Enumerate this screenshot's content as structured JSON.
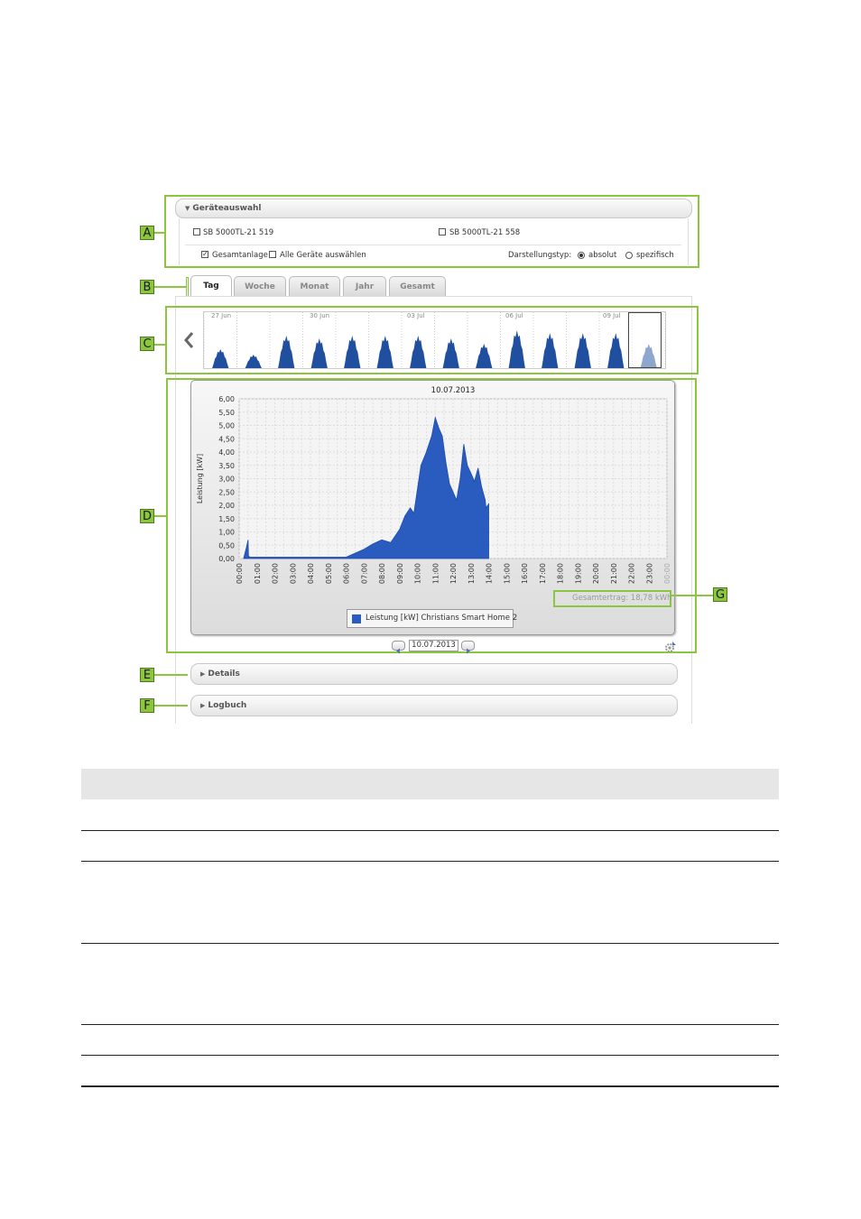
{
  "device_selection": {
    "header": "Geräteauswahl",
    "devices": [
      "SB 5000TL-21 519",
      "SB 5000TL-21 558"
    ],
    "total_plant_label": "Gesamtanlage",
    "total_plant_checked": true,
    "select_all_label": "Alle Geräte auswählen",
    "display_type_label": "Darstellungstyp:",
    "display_absolute": "absolut",
    "display_specific": "spezifisch",
    "display_selected": "absolut"
  },
  "tabs": [
    {
      "label": "Tag",
      "active": true
    },
    {
      "label": "Woche",
      "active": false
    },
    {
      "label": "Monat",
      "active": false
    },
    {
      "label": "Jahr",
      "active": false
    },
    {
      "label": "Gesamt",
      "active": false
    }
  ],
  "timeline": {
    "date_labels": [
      "27 Jun",
      "30 Jun",
      "03 Jul",
      "06 Jul",
      "09 Jul"
    ],
    "prev_icon": "chevron-left-icon"
  },
  "callouts": [
    "A",
    "B",
    "C",
    "D",
    "E",
    "F",
    "G"
  ],
  "chart_data": {
    "type": "area",
    "title": "10.07.2013",
    "ylabel": "Leistung [kW]",
    "xlabel": "",
    "ylim": [
      0,
      6
    ],
    "yticks": [
      "6,00",
      "5,50",
      "5,00",
      "4,50",
      "4,00",
      "3,50",
      "3,00",
      "2,50",
      "2,00",
      "1,50",
      "1,00",
      "0,50",
      "0,00"
    ],
    "xticks": [
      "00:00",
      "01:00",
      "02:00",
      "03:00",
      "04:00",
      "05:00",
      "06:00",
      "07:00",
      "08:00",
      "09:00",
      "10:00",
      "11:00",
      "12:00",
      "13:00",
      "14:00",
      "15:00",
      "16:00",
      "17:00",
      "18:00",
      "19:00",
      "20:00",
      "21:00",
      "22:00",
      "23:00",
      "00:00"
    ],
    "grid": true,
    "series": [
      {
        "name": "Leistung [kW] Christians Smart Home 2",
        "color": "#2a5cbf",
        "x": [
          0.25,
          0.4,
          0.5,
          0.52,
          0.6,
          6.0,
          6.5,
          7.0,
          7.5,
          8.0,
          8.5,
          9.0,
          9.3,
          9.6,
          9.8,
          10.0,
          10.2,
          10.5,
          10.8,
          11.0,
          11.2,
          11.4,
          11.6,
          11.8,
          12.0,
          12.2,
          12.4,
          12.6,
          12.8,
          13.0,
          13.2,
          13.4,
          13.6,
          13.8,
          13.85,
          14.0,
          14.0
        ],
        "y": [
          0.0,
          0.4,
          0.7,
          0.1,
          0.05,
          0.05,
          0.2,
          0.35,
          0.55,
          0.7,
          0.6,
          1.1,
          1.6,
          1.9,
          1.7,
          2.6,
          3.5,
          4.0,
          4.6,
          5.3,
          4.9,
          4.6,
          3.6,
          2.8,
          2.5,
          2.2,
          3.0,
          4.3,
          3.5,
          3.2,
          2.9,
          3.4,
          2.7,
          2.2,
          1.9,
          2.05,
          0.0
        ]
      }
    ],
    "legend": "bottom-center",
    "annotation": "Gesamtertrag: 18,78 kWh"
  },
  "navigation": {
    "date_value": "10.07.2013"
  },
  "sections": {
    "details": "Details",
    "logbook": "Logbuch"
  }
}
